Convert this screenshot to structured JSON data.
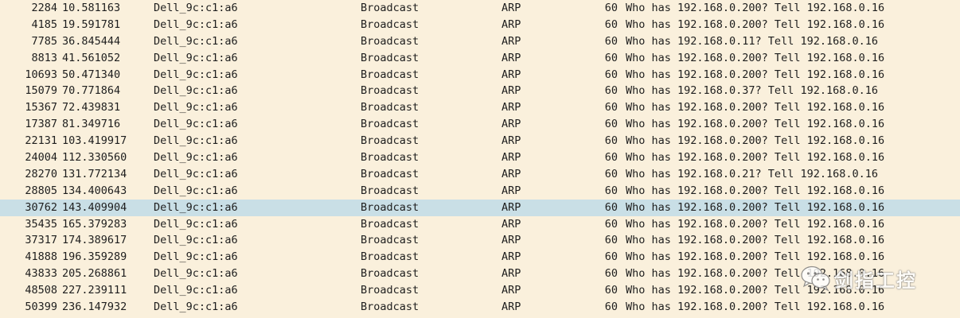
{
  "packets": [
    {
      "no": "2284",
      "time": "10.581163",
      "source": "Dell_9c:c1:a6",
      "destination": "Broadcast",
      "protocol": "ARP",
      "length": "60",
      "info": "Who has 192.168.0.200? Tell 192.168.0.16"
    },
    {
      "no": "4185",
      "time": "19.591781",
      "source": "Dell_9c:c1:a6",
      "destination": "Broadcast",
      "protocol": "ARP",
      "length": "60",
      "info": "Who has 192.168.0.200? Tell 192.168.0.16"
    },
    {
      "no": "7785",
      "time": "36.845444",
      "source": "Dell_9c:c1:a6",
      "destination": "Broadcast",
      "protocol": "ARP",
      "length": "60",
      "info": "Who has 192.168.0.11? Tell 192.168.0.16"
    },
    {
      "no": "8813",
      "time": "41.561052",
      "source": "Dell_9c:c1:a6",
      "destination": "Broadcast",
      "protocol": "ARP",
      "length": "60",
      "info": "Who has 192.168.0.200? Tell 192.168.0.16"
    },
    {
      "no": "10693",
      "time": "50.471340",
      "source": "Dell_9c:c1:a6",
      "destination": "Broadcast",
      "protocol": "ARP",
      "length": "60",
      "info": "Who has 192.168.0.200? Tell 192.168.0.16"
    },
    {
      "no": "15079",
      "time": "70.771864",
      "source": "Dell_9c:c1:a6",
      "destination": "Broadcast",
      "protocol": "ARP",
      "length": "60",
      "info": "Who has 192.168.0.37? Tell 192.168.0.16"
    },
    {
      "no": "15367",
      "time": "72.439831",
      "source": "Dell_9c:c1:a6",
      "destination": "Broadcast",
      "protocol": "ARP",
      "length": "60",
      "info": "Who has 192.168.0.200? Tell 192.168.0.16"
    },
    {
      "no": "17387",
      "time": "81.349716",
      "source": "Dell_9c:c1:a6",
      "destination": "Broadcast",
      "protocol": "ARP",
      "length": "60",
      "info": "Who has 192.168.0.200? Tell 192.168.0.16"
    },
    {
      "no": "22131",
      "time": "103.419917",
      "source": "Dell_9c:c1:a6",
      "destination": "Broadcast",
      "protocol": "ARP",
      "length": "60",
      "info": "Who has 192.168.0.200? Tell 192.168.0.16"
    },
    {
      "no": "24004",
      "time": "112.330560",
      "source": "Dell_9c:c1:a6",
      "destination": "Broadcast",
      "protocol": "ARP",
      "length": "60",
      "info": "Who has 192.168.0.200? Tell 192.168.0.16"
    },
    {
      "no": "28270",
      "time": "131.772134",
      "source": "Dell_9c:c1:a6",
      "destination": "Broadcast",
      "protocol": "ARP",
      "length": "60",
      "info": "Who has 192.168.0.21? Tell 192.168.0.16"
    },
    {
      "no": "28805",
      "time": "134.400643",
      "source": "Dell_9c:c1:a6",
      "destination": "Broadcast",
      "protocol": "ARP",
      "length": "60",
      "info": "Who has 192.168.0.200? Tell 192.168.0.16"
    },
    {
      "no": "30762",
      "time": "143.409904",
      "source": "Dell_9c:c1:a6",
      "destination": "Broadcast",
      "protocol": "ARP",
      "length": "60",
      "info": "Who has 192.168.0.200? Tell 192.168.0.16"
    },
    {
      "no": "35435",
      "time": "165.379283",
      "source": "Dell_9c:c1:a6",
      "destination": "Broadcast",
      "protocol": "ARP",
      "length": "60",
      "info": "Who has 192.168.0.200? Tell 192.168.0.16"
    },
    {
      "no": "37317",
      "time": "174.389617",
      "source": "Dell_9c:c1:a6",
      "destination": "Broadcast",
      "protocol": "ARP",
      "length": "60",
      "info": "Who has 192.168.0.200? Tell 192.168.0.16"
    },
    {
      "no": "41888",
      "time": "196.359289",
      "source": "Dell_9c:c1:a6",
      "destination": "Broadcast",
      "protocol": "ARP",
      "length": "60",
      "info": "Who has 192.168.0.200? Tell 192.168.0.16"
    },
    {
      "no": "43833",
      "time": "205.268861",
      "source": "Dell_9c:c1:a6",
      "destination": "Broadcast",
      "protocol": "ARP",
      "length": "60",
      "info": "Who has 192.168.0.200? Tell 192.168.0.16"
    },
    {
      "no": "48508",
      "time": "227.239111",
      "source": "Dell_9c:c1:a6",
      "destination": "Broadcast",
      "protocol": "ARP",
      "length": "60",
      "info": "Who has 192.168.0.200? Tell 192.168.0.16"
    },
    {
      "no": "50399",
      "time": "236.147932",
      "source": "Dell_9c:c1:a6",
      "destination": "Broadcast",
      "protocol": "ARP",
      "length": "60",
      "info": "Who has 192.168.0.200? Tell 192.168.0.16"
    }
  ],
  "selected_row": "30762",
  "watermark": {
    "text": "剑指工控",
    "icon": "wechat-icon"
  },
  "colors": {
    "row_background": "#faf0dc",
    "selected_background": "#c9dfe6",
    "text": "#1e1e1e"
  }
}
